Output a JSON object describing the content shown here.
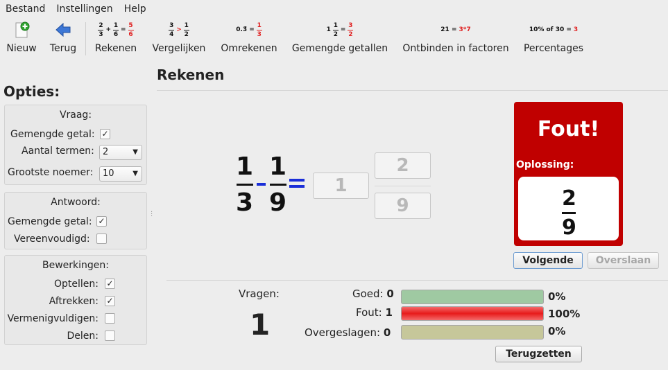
{
  "menu": [
    "Bestand",
    "Instellingen",
    "Help"
  ],
  "toolbar": {
    "new_label": "Nieuw",
    "back_label": "Terug",
    "modes": [
      {
        "label": "Rekenen",
        "icon": "add-fractions-icon"
      },
      {
        "label": "Vergelijken",
        "icon": "compare-fractions-icon"
      },
      {
        "label": "Omrekenen",
        "icon": "convert-decimal-icon"
      },
      {
        "label": "Gemengde getallen",
        "icon": "mixed-numbers-icon"
      },
      {
        "label": "Ontbinden in factoren",
        "icon": "factorize-icon"
      },
      {
        "label": "Percentages",
        "icon": "percentage-icon"
      }
    ],
    "icon_text": {
      "rekenen": {
        "a_n": "2",
        "a_d": "3",
        "op": "+",
        "b_n": "1",
        "b_d": "6",
        "eq": "=",
        "r_n": "5",
        "r_d": "6"
      },
      "vergelijken": {
        "a_n": "3",
        "a_d": "4",
        "op": ">",
        "b_n": "1",
        "b_d": "2"
      },
      "omrekenen": {
        "left": "0.3̄ =",
        "r_n": "1",
        "r_d": "3"
      },
      "gemengde": {
        "whole": "1",
        "a_n": "1",
        "a_d": "2",
        "eq": "=",
        "r_n": "3",
        "r_d": "2"
      },
      "ontbinden": {
        "left": "21 =",
        "right": "3*7"
      },
      "percentages": {
        "left": "10% of 30 =",
        "right": "3"
      }
    }
  },
  "sidebar": {
    "title": "Opties:",
    "vraag": {
      "title": "Vraag:",
      "mixed_label": "Gemengde getal:",
      "mixed_checked": true,
      "terms_label": "Aantal termen:",
      "terms_value": "2",
      "denominator_label": "Grootste noemer:",
      "denominator_value": "10"
    },
    "antwoord": {
      "title": "Antwoord:",
      "mixed_label": "Gemengde getal:",
      "mixed_checked": true,
      "simplified_label": "Vereenvoudigd:",
      "simplified_checked": false
    },
    "bewerkingen": {
      "title": "Bewerkingen:",
      "items": [
        {
          "label": "Optellen:",
          "checked": true
        },
        {
          "label": "Aftrekken:",
          "checked": true
        },
        {
          "label": "Vermenigvuldigen:",
          "checked": false
        },
        {
          "label": "Delen:",
          "checked": false
        }
      ]
    }
  },
  "main": {
    "title": "Rekenen",
    "task": {
      "a_num": "1",
      "a_den": "3",
      "b_num": "1",
      "b_den": "9",
      "answer_whole": "1",
      "answer_num": "2",
      "answer_den": "9"
    },
    "result": {
      "title": "Fout!",
      "solution_label": "Oplossing:",
      "solution_num": "2",
      "solution_den": "9"
    },
    "next_label": "Volgende",
    "skip_label": "Overslaan"
  },
  "stats": {
    "questions_label": "Vragen:",
    "questions_value": "1",
    "rows": [
      {
        "label": "Goed:",
        "value": "0",
        "percent_text": "0%",
        "fraction": 0,
        "color": "#9fc9a2"
      },
      {
        "label": "Fout:",
        "value": "1",
        "percent_text": "100%",
        "fraction": 1,
        "color": "#e81b1b"
      },
      {
        "label": "Overgeslagen:",
        "value": "0",
        "percent_text": "0%",
        "fraction": 0,
        "color": "#c6c79a"
      }
    ],
    "reset_label": "Terugzetten"
  }
}
